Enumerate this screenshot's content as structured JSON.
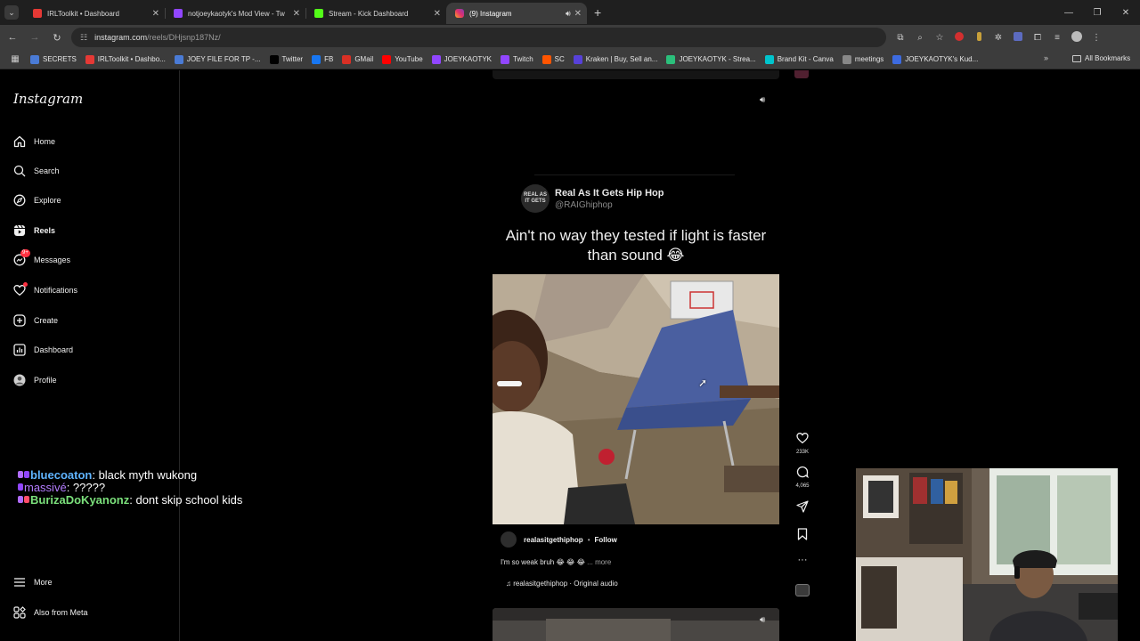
{
  "browser": {
    "tabs": [
      {
        "title": "IRLToolkit • Dashboard",
        "color": "#e53935",
        "active": false
      },
      {
        "title": "notjoeykaotyk's Mod View - Tw",
        "color": "#9146ff",
        "active": false
      },
      {
        "title": "Stream - Kick Dashboard",
        "color": "#53fc18",
        "active": false
      },
      {
        "title": "(9) Instagram",
        "color": "#e1306c",
        "active": true
      }
    ],
    "url_host": "instagram.com",
    "url_path": "/reels/DHjsnp187Nz/",
    "bookmarks": [
      {
        "label": "SECRETS",
        "color": "#4a7bd6"
      },
      {
        "label": "IRLToolkit • Dashbo...",
        "color": "#e53935"
      },
      {
        "label": "JOEY FILE FOR TP -...",
        "color": "#4a7bd6"
      },
      {
        "label": "Twitter",
        "color": "#000000"
      },
      {
        "label": "FB",
        "color": "#1877f2"
      },
      {
        "label": "GMail",
        "color": "#d93025"
      },
      {
        "label": "YouTube",
        "color": "#ff0000"
      },
      {
        "label": "JOEYKAOTYK",
        "color": "#9146ff"
      },
      {
        "label": "Twitch",
        "color": "#9146ff"
      },
      {
        "label": "SC",
        "color": "#ff5500"
      },
      {
        "label": "Kraken | Buy, Sell an...",
        "color": "#5741d9"
      },
      {
        "label": "JOEYKAOTYK - Strea...",
        "color": "#2bbf7b"
      },
      {
        "label": "Brand Kit - Canva",
        "color": "#00c4cc"
      },
      {
        "label": "meetings",
        "color": "#888888"
      },
      {
        "label": "JOEYKAOTYK's Kud...",
        "color": "#3d6be0"
      }
    ],
    "all_bookmarks": "All Bookmarks"
  },
  "instagram": {
    "logo": "Instagram",
    "nav": [
      {
        "label": "Home",
        "icon": "home-icon"
      },
      {
        "label": "Search",
        "icon": "search-icon"
      },
      {
        "label": "Explore",
        "icon": "explore-icon"
      },
      {
        "label": "Reels",
        "icon": "reels-icon"
      },
      {
        "label": "Messages",
        "icon": "messages-icon",
        "badge": "9+"
      },
      {
        "label": "Notifications",
        "icon": "heart-icon"
      },
      {
        "label": "Create",
        "icon": "create-icon"
      },
      {
        "label": "Dashboard",
        "icon": "dashboard-icon"
      },
      {
        "label": "Profile",
        "icon": "profile-icon"
      }
    ],
    "more": "More",
    "also_from_meta": "Also from Meta"
  },
  "chat": [
    {
      "user": "bluecoaton",
      "message": ": black myth wukong"
    },
    {
      "user": "massivé",
      "message": ": ?????"
    },
    {
      "user": "BurizaDoKyanonz",
      "message": ": dont skip school kids"
    }
  ],
  "post": {
    "page_name": "Real As It Gets Hip Hop",
    "page_handle": "@RAIGhiphop",
    "avatar_text": "REAL AS IT GETS",
    "headline": "Ain't no way they tested if light is faster than sound 😂",
    "uploader": "realasitgethiphop",
    "follow": "Follow",
    "caption": "I'm so weak bruh 😂 😂 😂",
    "more": "... more",
    "audio": "realasitgethiphop · Original audio",
    "likes": "233K",
    "comments": "4,065"
  }
}
